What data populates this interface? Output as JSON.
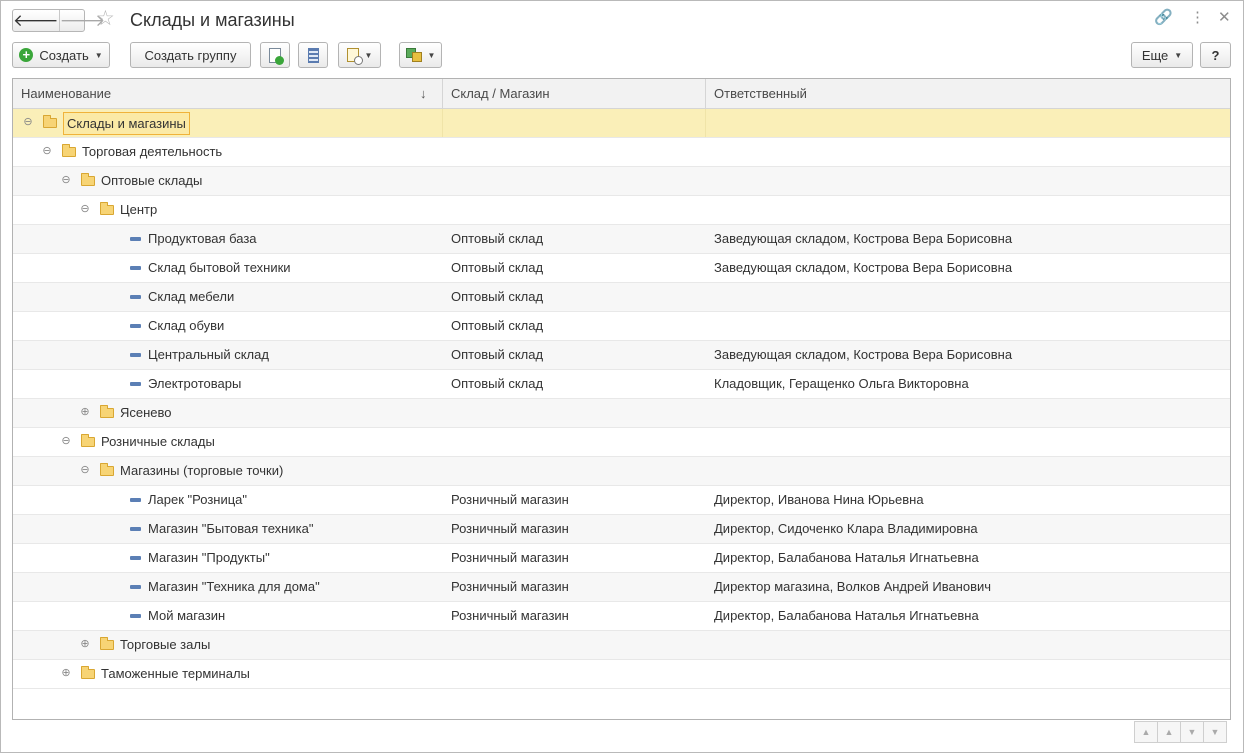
{
  "window": {
    "title": "Склады и магазины"
  },
  "toolbar": {
    "create_label": "Создать",
    "create_group_label": "Создать группу",
    "more_label": "Еще",
    "help_label": "?"
  },
  "table": {
    "headers": {
      "name": "Наименование",
      "type": "Склад / Магазин",
      "responsible": "Ответственный"
    },
    "rows": [
      {
        "name": "Склады и магазины",
        "type": "",
        "responsible": ""
      },
      {
        "name": "Торговая деятельность",
        "type": "",
        "responsible": ""
      },
      {
        "name": "Оптовые склады",
        "type": "",
        "responsible": ""
      },
      {
        "name": "Центр",
        "type": "",
        "responsible": ""
      },
      {
        "name": "Продуктовая база",
        "type": "Оптовый склад",
        "responsible": "Заведующая складом, Кострова Вера Борисовна"
      },
      {
        "name": "Склад бытовой техники",
        "type": "Оптовый склад",
        "responsible": "Заведующая складом, Кострова Вера Борисовна"
      },
      {
        "name": "Склад мебели",
        "type": "Оптовый склад",
        "responsible": ""
      },
      {
        "name": "Склад обуви",
        "type": "Оптовый склад",
        "responsible": ""
      },
      {
        "name": "Центральный склад",
        "type": "Оптовый склад",
        "responsible": "Заведующая складом, Кострова Вера Борисовна"
      },
      {
        "name": "Электротовары",
        "type": "Оптовый склад",
        "responsible": "Кладовщик, Геращенко Ольга Викторовна"
      },
      {
        "name": "Ясенево",
        "type": "",
        "responsible": ""
      },
      {
        "name": "Розничные склады",
        "type": "",
        "responsible": ""
      },
      {
        "name": "Магазины (торговые точки)",
        "type": "",
        "responsible": ""
      },
      {
        "name": "Ларек \"Розница\"",
        "type": "Розничный магазин",
        "responsible": "Директор, Иванова Нина Юрьевна"
      },
      {
        "name": "Магазин \"Бытовая техника\"",
        "type": "Розничный магазин",
        "responsible": "Директор, Сидоченко Клара Владимировна"
      },
      {
        "name": "Магазин \"Продукты\"",
        "type": "Розничный магазин",
        "responsible": "Директор, Балабанова Наталья Игнатьевна"
      },
      {
        "name": "Магазин \"Техника для дома\"",
        "type": "Розничный магазин",
        "responsible": "Директор магазина, Волков Андрей Иванович"
      },
      {
        "name": "Мой магазин",
        "type": "Розничный магазин",
        "responsible": "Директор, Балабанова Наталья Игнатьевна"
      },
      {
        "name": "Торговые залы",
        "type": "",
        "responsible": ""
      },
      {
        "name": "Таможенные терминалы",
        "type": "",
        "responsible": ""
      }
    ]
  }
}
